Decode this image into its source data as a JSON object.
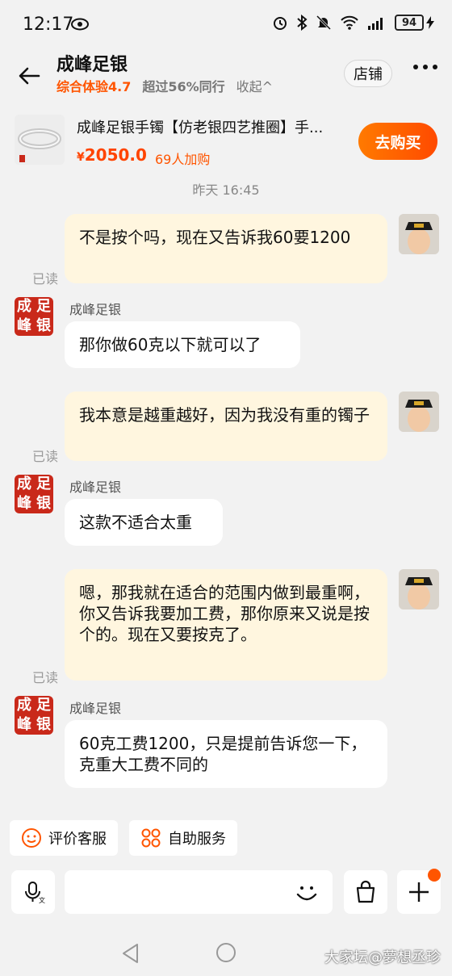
{
  "status": {
    "time": "12:17",
    "battery": "94"
  },
  "header": {
    "title": "成峰足银",
    "score": "综合体验4.7",
    "rank": "超过56%同行",
    "collapse": "收起^",
    "store_btn": "店铺"
  },
  "product": {
    "title": "成峰足银手镯【仿老银四艺推圈】手...",
    "currency": "¥",
    "price": "2050.0",
    "sold": "69人加购",
    "buy_btn": "去购买"
  },
  "chat": {
    "timestamp": "昨天  16:45",
    "messages": [
      {
        "from": "me",
        "text": "不是按个吗，现在又告诉我60要1200",
        "read": "已读"
      },
      {
        "from": "shop",
        "sender": "成峰足银",
        "text": "那你做60克以下就可以了"
      },
      {
        "from": "me",
        "text": "我本意是越重越好，因为我没有重的镯子",
        "read": "已读"
      },
      {
        "from": "shop",
        "sender": "成峰足银",
        "text": "这款不适合太重"
      },
      {
        "from": "me",
        "text": "嗯，那我就在适合的范围内做到最重啊，你又告诉我要加工费，那你原来又说是按个的。现在又要按克了。",
        "read": "已读"
      },
      {
        "from": "shop",
        "sender": "成峰足银",
        "text": "60克工费1200，只是提前告诉您一下，克重大工费不同的"
      }
    ],
    "shop_avatar_chars": [
      "成",
      "足",
      "峰",
      "银"
    ]
  },
  "quick": {
    "review": "评价客服",
    "self_service": "自助服务"
  },
  "input": {
    "placeholder": ""
  },
  "watermark": "大家坛@夢想丞珍",
  "colors": {
    "accent": "#ff5500",
    "my_bubble": "#fff6df",
    "shop_avatar": "#c9291a"
  }
}
